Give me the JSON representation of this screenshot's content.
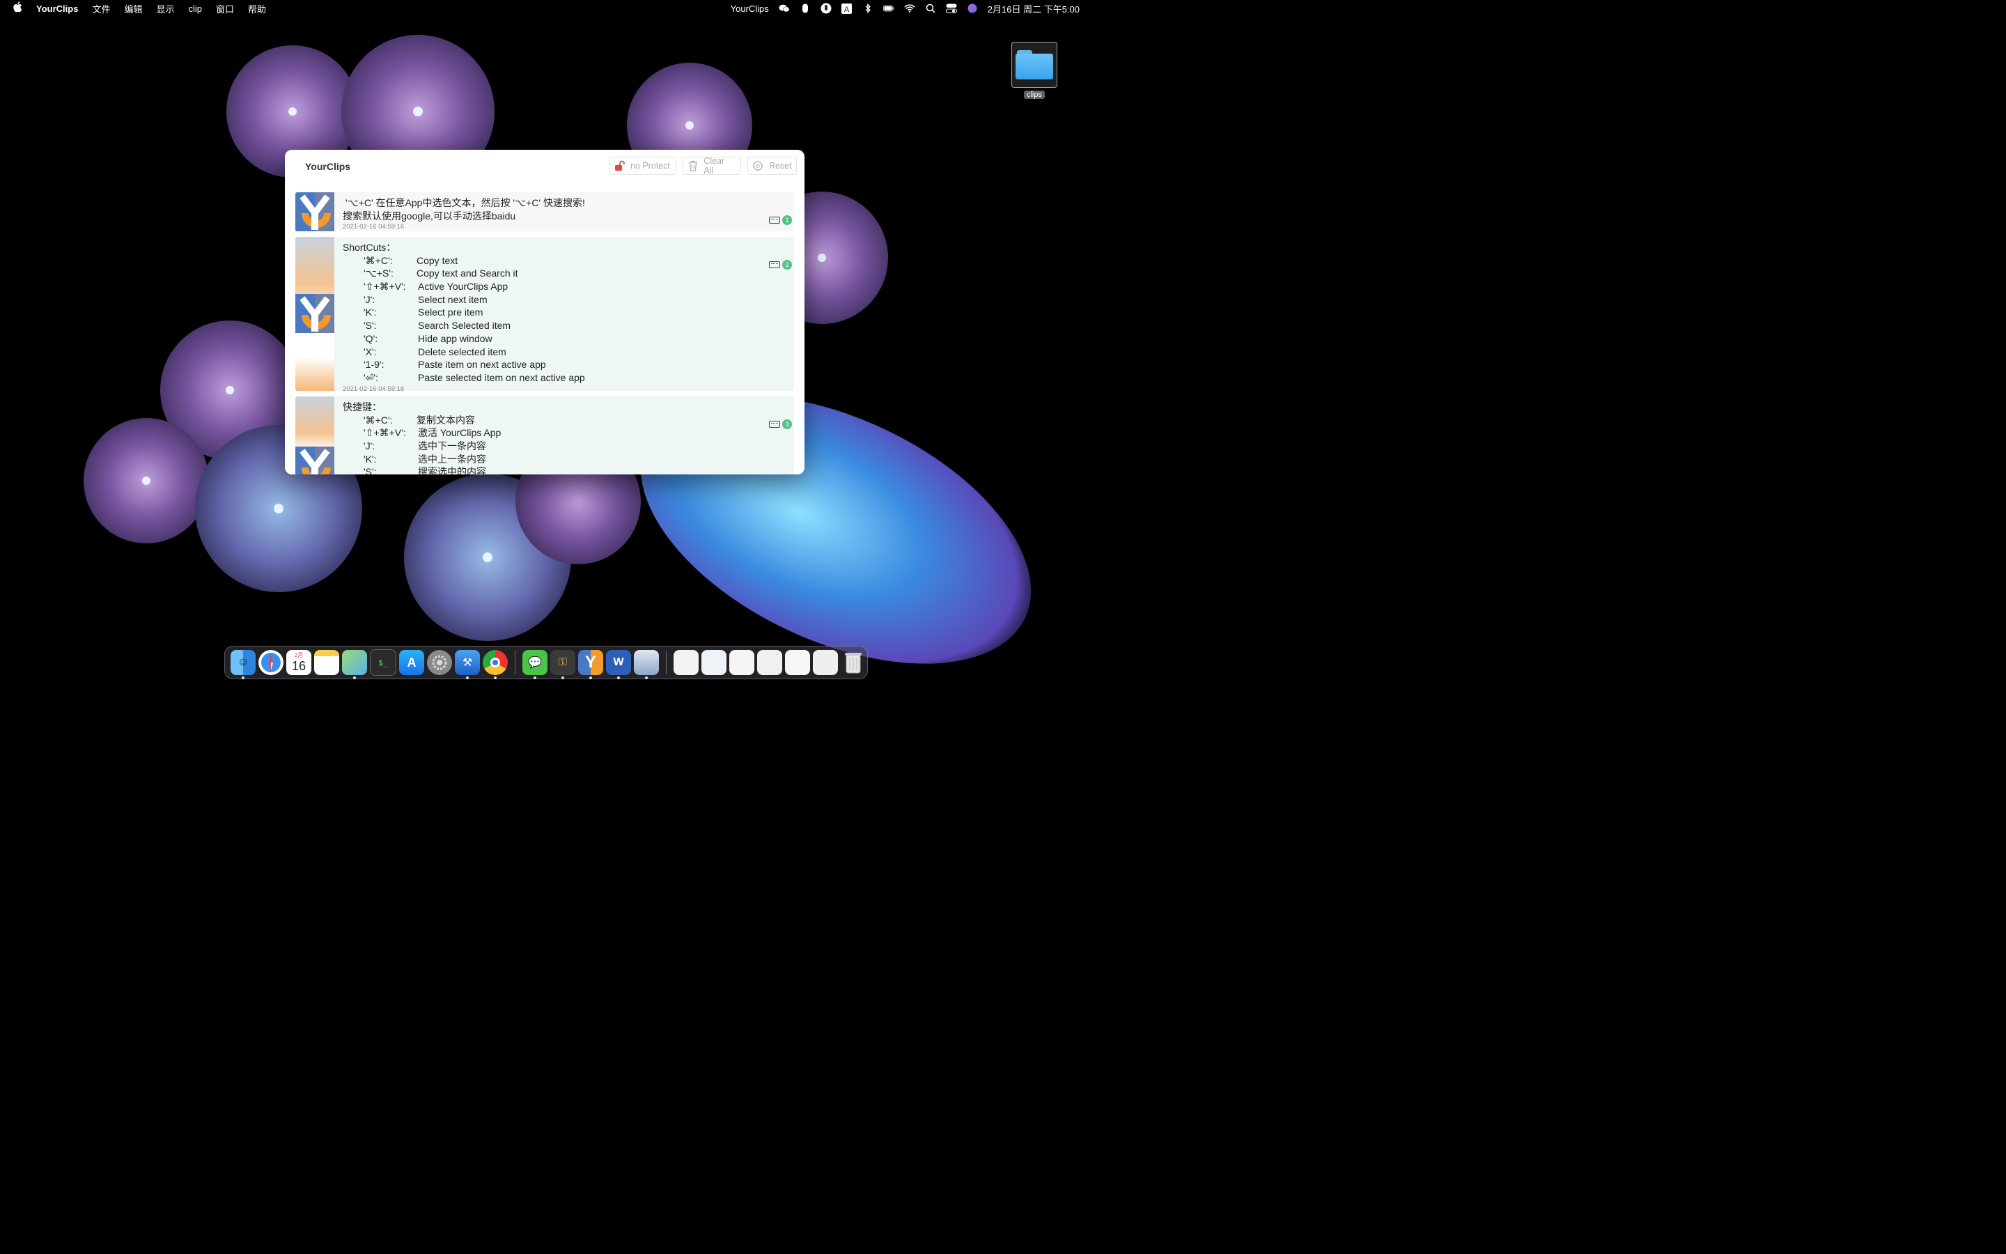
{
  "menubar": {
    "app_name": "YourClips",
    "menus": [
      "文件",
      "编辑",
      "显示",
      "clip",
      "窗口",
      "帮助"
    ],
    "status_app": "YourClips",
    "datetime": "2月16日 周二 下午5:00",
    "status_icons": [
      "wechat-icon",
      "mouse-icon",
      "scroll-icon",
      "input-method-icon",
      "bluetooth-icon",
      "battery-icon",
      "wifi-icon",
      "search-icon",
      "control-center-icon",
      "siri-icon"
    ]
  },
  "desktop": {
    "folder_label": "clips"
  },
  "window": {
    "title": "YourClips",
    "buttons": {
      "protect": "no Protect",
      "clear": "Clear All",
      "reset": "Reset"
    },
    "items": [
      {
        "index": "1",
        "lines": [
          " '⌥+C' 在任意App中选色文本，然后按 '⌥+C' 快速搜索!",
          "搜索默认使用google,可以手动选择baidu"
        ],
        "time": "2021-02-16 04:59:16"
      },
      {
        "index": "2",
        "title": "ShortCuts：",
        "rows": [
          {
            "key": "'⌘+C':",
            "desc": "Copy text"
          },
          {
            "key": "'⌥+S':",
            "desc": "Copy text and Search it"
          },
          {
            "key": "'⇧+⌘+V':",
            "desc": "Active YourClips App"
          },
          {
            "key": "'J':",
            "desc": "Select next item"
          },
          {
            "key": "'K':",
            "desc": "Select pre item"
          },
          {
            "key": "'S':",
            "desc": "Search Selected item"
          },
          {
            "key": "'Q':",
            "desc": "Hide app window"
          },
          {
            "key": "'X':",
            "desc": "Delete selected item"
          },
          {
            "key": "'1-9':",
            "desc": "Paste item on next active app"
          },
          {
            "key": "'⏎':",
            "desc": "Paste selected item on next active app"
          }
        ],
        "time": "2021-02-16 04:59:16"
      },
      {
        "index": "3",
        "title": "快捷键：",
        "rows": [
          {
            "key": "'⌘+C':",
            "desc": "复制文本内容"
          },
          {
            "key": "'⇧+⌘+V':",
            "desc": "激活 YourClips App"
          },
          {
            "key": "'J':",
            "desc": "选中下一条内容"
          },
          {
            "key": "'K':",
            "desc": "选中上一条内容"
          },
          {
            "key": "'S':",
            "desc": "搜索选中的内容"
          }
        ]
      }
    ]
  },
  "dock": {
    "calendar_month": "2月",
    "calendar_day": "16",
    "apps": [
      "finder-icon",
      "safari-icon",
      "calendar-icon",
      "notes-icon",
      "maps-icon",
      "terminal-icon",
      "app-store-icon",
      "system-preferences-icon",
      "xcode-icon",
      "chrome-icon",
      "wechat-icon",
      "keychain-icon",
      "yourclips-icon",
      "word-icon",
      "preview-icon"
    ],
    "recents": [
      "document-icon",
      "document-icon",
      "document-icon",
      "document-icon",
      "document-icon",
      "document-icon",
      "trash-icon"
    ]
  },
  "colors": {
    "accent_green": "#55c08a",
    "protect_red": "#e2483d",
    "logo_orange": "#f39a2c",
    "logo_blue": "#4a79c4"
  }
}
